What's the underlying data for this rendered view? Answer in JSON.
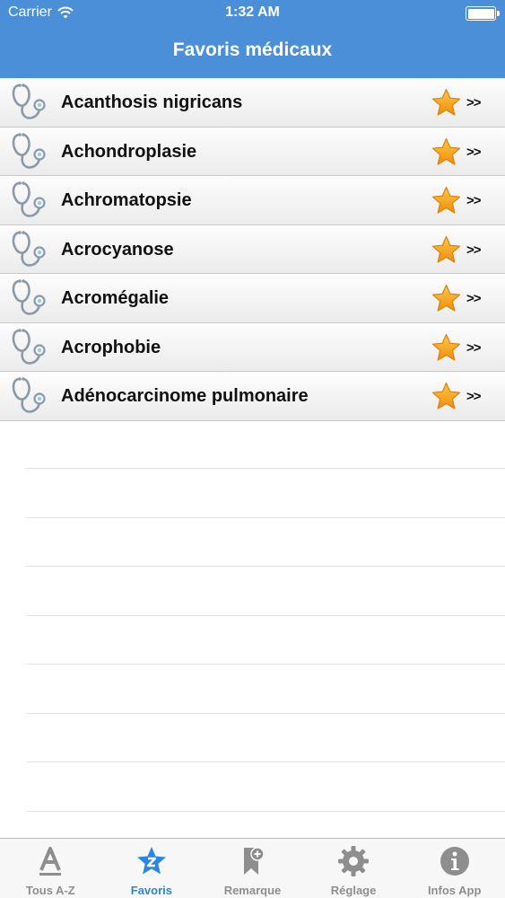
{
  "status_bar": {
    "carrier": "Carrier",
    "time": "1:32 AM"
  },
  "nav": {
    "title": "Favoris médicaux"
  },
  "favorites": {
    "arrow_label": ">>",
    "items": [
      {
        "label": "Acanthosis nigricans"
      },
      {
        "label": "Achondroplasie"
      },
      {
        "label": "Achromatopsie"
      },
      {
        "label": "Acrocyanose"
      },
      {
        "label": "Acromégalie"
      },
      {
        "label": "Acrophobie"
      },
      {
        "label": "Adénocarcinome pulmonaire"
      }
    ]
  },
  "tabbar": {
    "tabs": [
      {
        "label": "Tous A-Z",
        "icon": "letter-a-icon",
        "active": false
      },
      {
        "label": "Favoris",
        "icon": "star-z-icon",
        "active": true
      },
      {
        "label": "Remarque",
        "icon": "bookmark-plus-icon",
        "active": false
      },
      {
        "label": "Réglage",
        "icon": "gear-icon",
        "active": false
      },
      {
        "label": "Infos App",
        "icon": "info-icon",
        "active": false
      }
    ]
  },
  "colors": {
    "header": "#4a8fd7",
    "active_tab": "#2a86e2",
    "inactive_tab": "#8e8e8e",
    "star": "#f4a21d"
  }
}
